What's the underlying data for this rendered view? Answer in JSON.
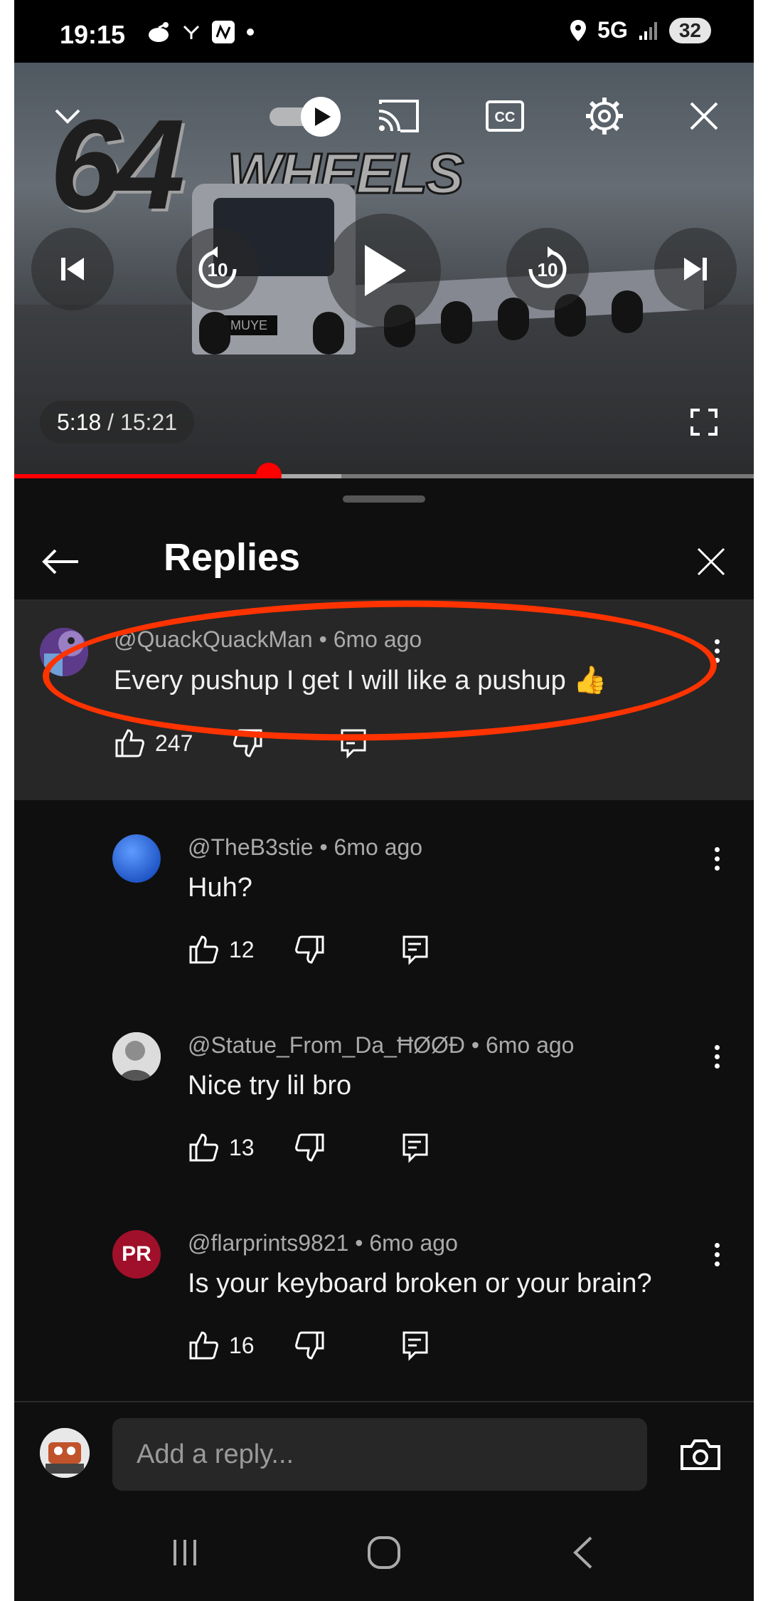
{
  "status_bar": {
    "time": "19:15",
    "network": "5G",
    "battery": "32"
  },
  "video": {
    "logo_number": "64",
    "logo_word": "WHEELS",
    "plate": "MUYE",
    "current_time": "5:18",
    "separator": " / ",
    "duration": "15:21",
    "progress_fraction": 0.344,
    "skip_seconds": "10"
  },
  "replies_panel": {
    "title": "Replies",
    "reply_placeholder": "Add a reply..."
  },
  "parent_comment": {
    "author": "@QuackQuackMan",
    "age": "6mo ago",
    "text": "Every pushup I get I will like a pushup 👍",
    "likes": "247"
  },
  "replies": [
    {
      "author": "@TheB3stie",
      "age": "6mo ago",
      "text": "Huh?",
      "likes": "12",
      "avatar_color": "#2f6fe0"
    },
    {
      "author": "@Statue_From_Da_ĦØØĐ",
      "age": "6mo ago",
      "text": "Nice try lil bro",
      "likes": "13",
      "avatar_color": "#d8d8d8"
    },
    {
      "author": "@flarprints9821",
      "age": "6mo ago",
      "text": "Is your keyboard broken or your brain?",
      "likes": "16",
      "avatar_color": "#a0102a",
      "avatar_text": "PR"
    }
  ],
  "colors": {
    "accent_red": "#ff0000",
    "annotation_orange": "#ff3300",
    "sheet_bg": "#0f0f0f",
    "highlight_bg": "#272727"
  }
}
